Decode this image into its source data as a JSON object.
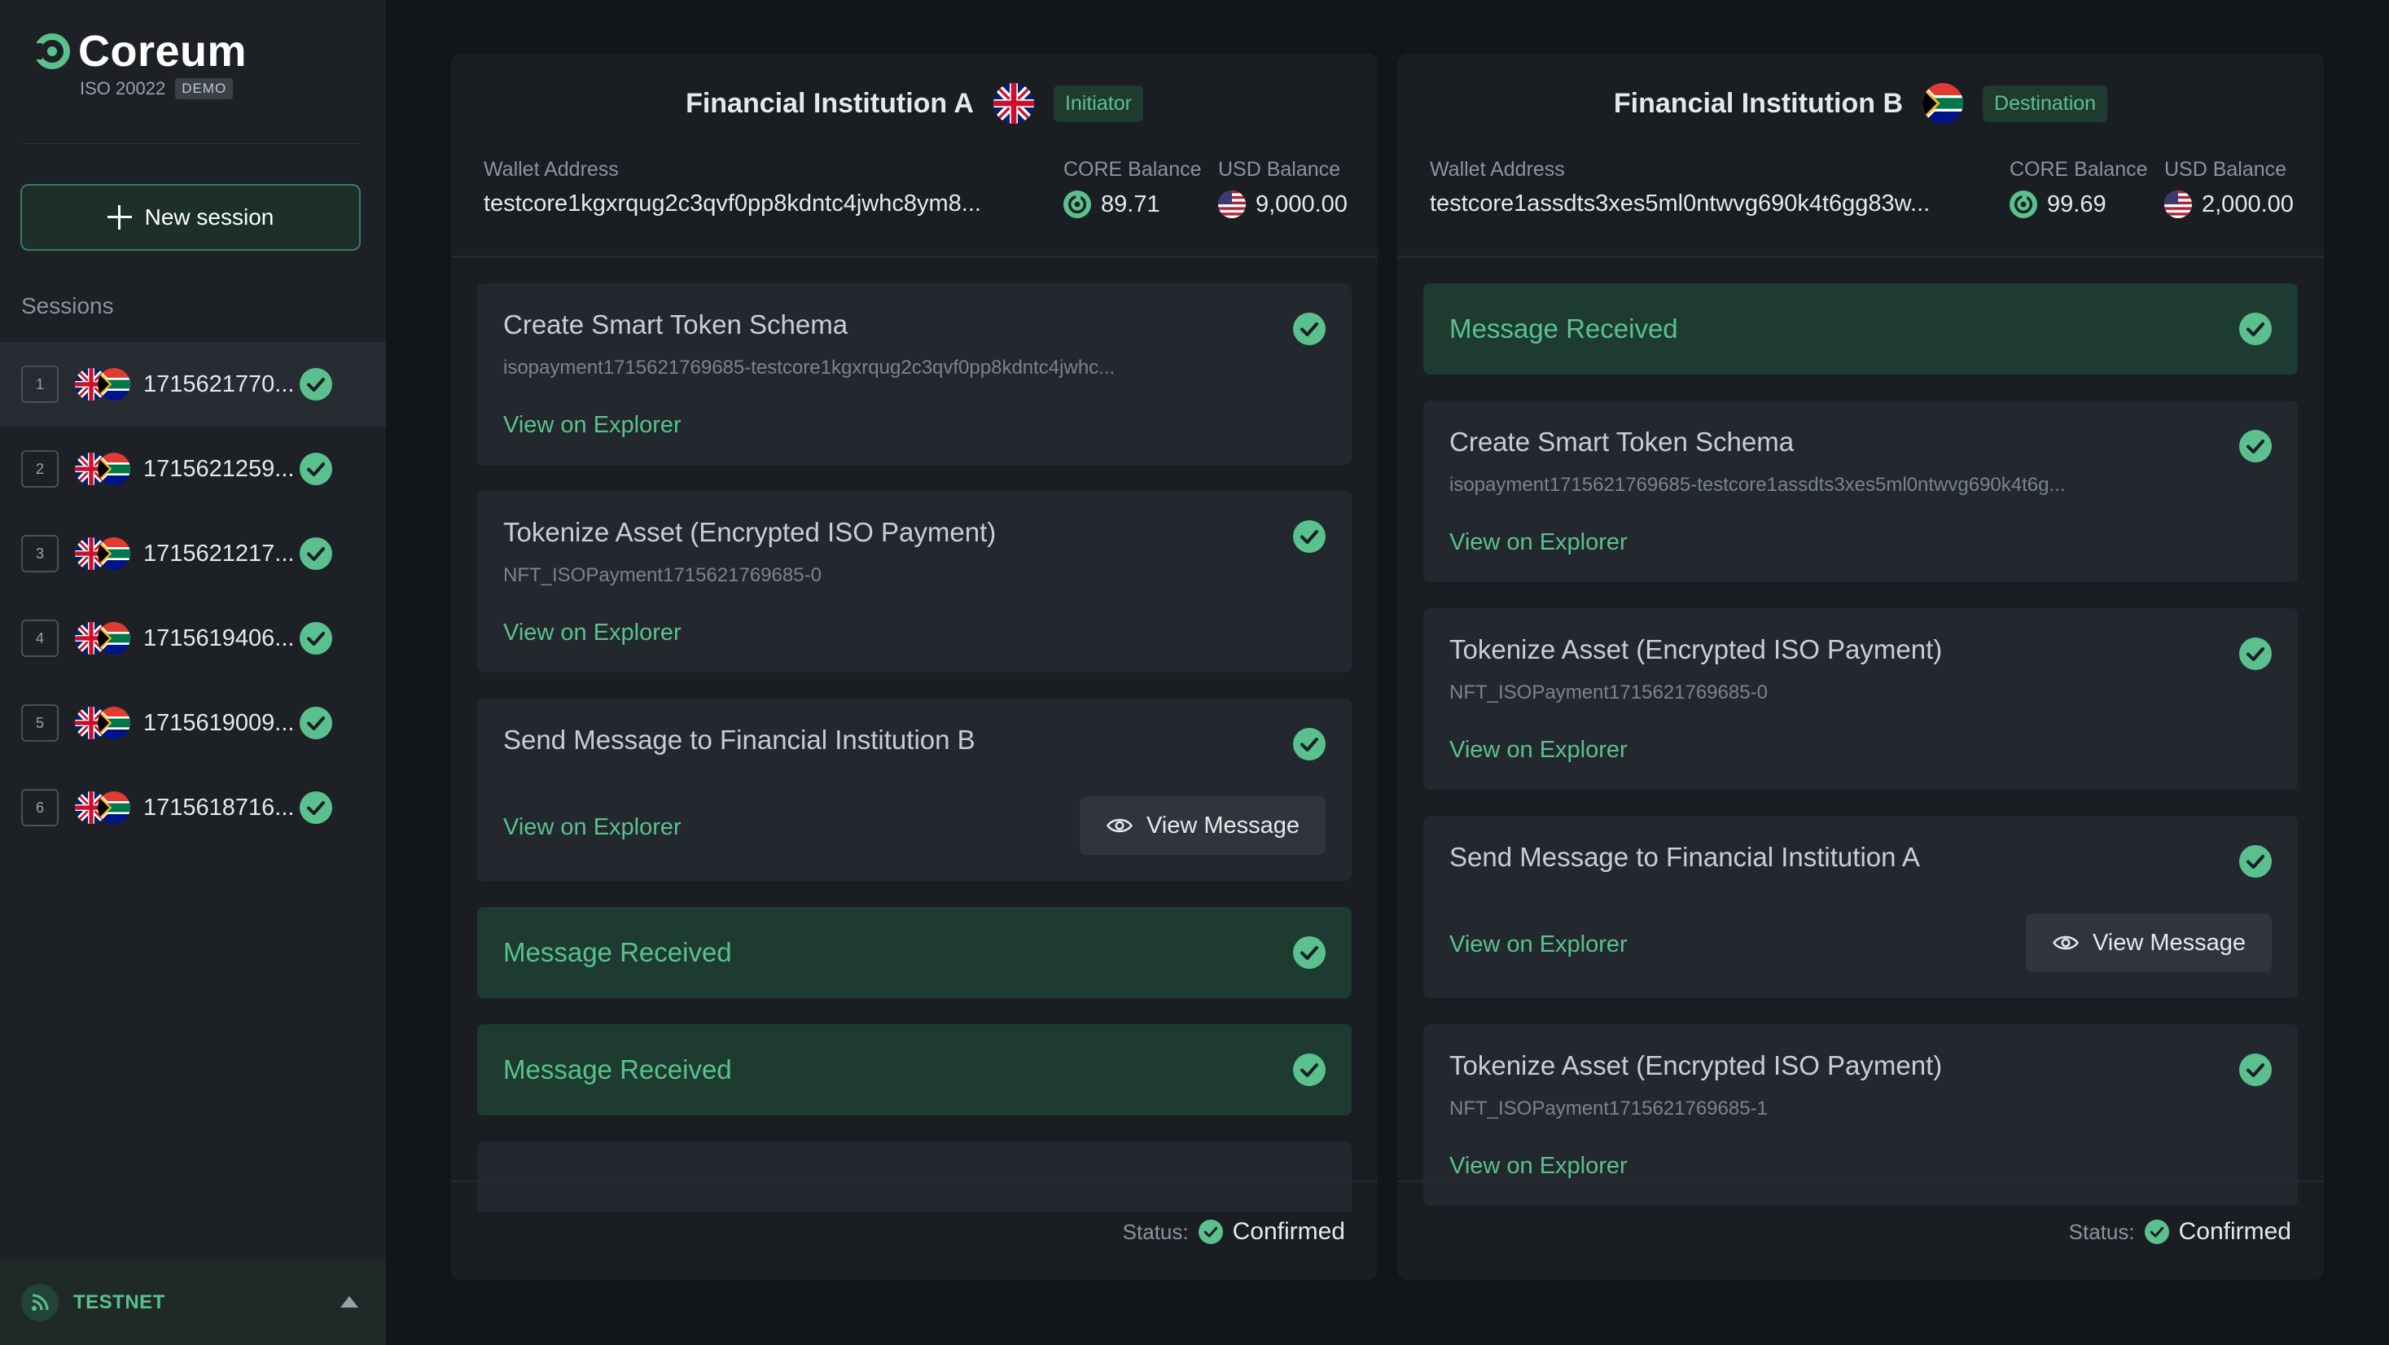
{
  "app": {
    "name": "Coreum",
    "subtitle": "ISO 20022",
    "badge": "DEMO"
  },
  "sidebar": {
    "new_session_label": "New session",
    "sessions_label": "Sessions",
    "sessions": [
      {
        "num": "1",
        "id": "1715621770...",
        "active": true
      },
      {
        "num": "2",
        "id": "1715621259..."
      },
      {
        "num": "3",
        "id": "1715621217..."
      },
      {
        "num": "4",
        "id": "1715619406..."
      },
      {
        "num": "5",
        "id": "1715619009..."
      },
      {
        "num": "6",
        "id": "1715618716..."
      }
    ],
    "network": "TESTNET"
  },
  "panel_a": {
    "title": "Financial Institution A",
    "role": "Initiator",
    "wallet_label": "Wallet Address",
    "wallet": "testcore1kgxrqug2c3qvf0pp8kdntc4jwhc8ym8...",
    "core_label": "CORE Balance",
    "core_value": "89.71",
    "usd_label": "USD Balance",
    "usd_value": "9,000.00",
    "steps": [
      {
        "title": "Create Smart Token Schema",
        "sub": "isopayment1715621769685-testcore1kgxrqug2c3qvf0pp8kdntc4jwhc...",
        "link": "View on Explorer"
      },
      {
        "title": "Tokenize Asset (Encrypted ISO Payment)",
        "sub": "NFT_ISOPayment1715621769685-0",
        "link": "View on Explorer"
      },
      {
        "title": "Send Message to Financial Institution B",
        "link": "View on Explorer",
        "button": "View Message"
      },
      {
        "title": "Message Received"
      },
      {
        "title": "Message Received"
      }
    ],
    "status_label": "Status:",
    "status_value": "Confirmed"
  },
  "panel_b": {
    "title": "Financial Institution B",
    "role": "Destination",
    "wallet_label": "Wallet Address",
    "wallet": "testcore1assdts3xes5ml0ntwvg690k4t6gg83w...",
    "core_label": "CORE Balance",
    "core_value": "99.69",
    "usd_label": "USD Balance",
    "usd_value": "2,000.00",
    "steps": [
      {
        "title": "Message Received"
      },
      {
        "title": "Create Smart Token Schema",
        "sub": "isopayment1715621769685-testcore1assdts3xes5ml0ntwvg690k4t6g...",
        "link": "View on Explorer"
      },
      {
        "title": "Tokenize Asset (Encrypted ISO Payment)",
        "sub": "NFT_ISOPayment1715621769685-0",
        "link": "View on Explorer"
      },
      {
        "title": "Send Message to Financial Institution A",
        "link": "View on Explorer",
        "button": "View Message"
      },
      {
        "title": "Tokenize Asset (Encrypted ISO Payment)",
        "sub": "NFT_ISOPayment1715621769685-1",
        "link": "View on Explorer"
      }
    ],
    "status_label": "Status:",
    "status_value": "Confirmed"
  },
  "colors": {
    "accent": "#5ac18e",
    "background": "#121519",
    "sidebar": "#1d2126"
  },
  "icons": {
    "check": "check-circle-icon",
    "eye": "eye-icon",
    "core": "core-coin-icon",
    "usd": "us-flag-icon",
    "uk": "uk-flag-icon",
    "za": "za-flag-icon"
  }
}
